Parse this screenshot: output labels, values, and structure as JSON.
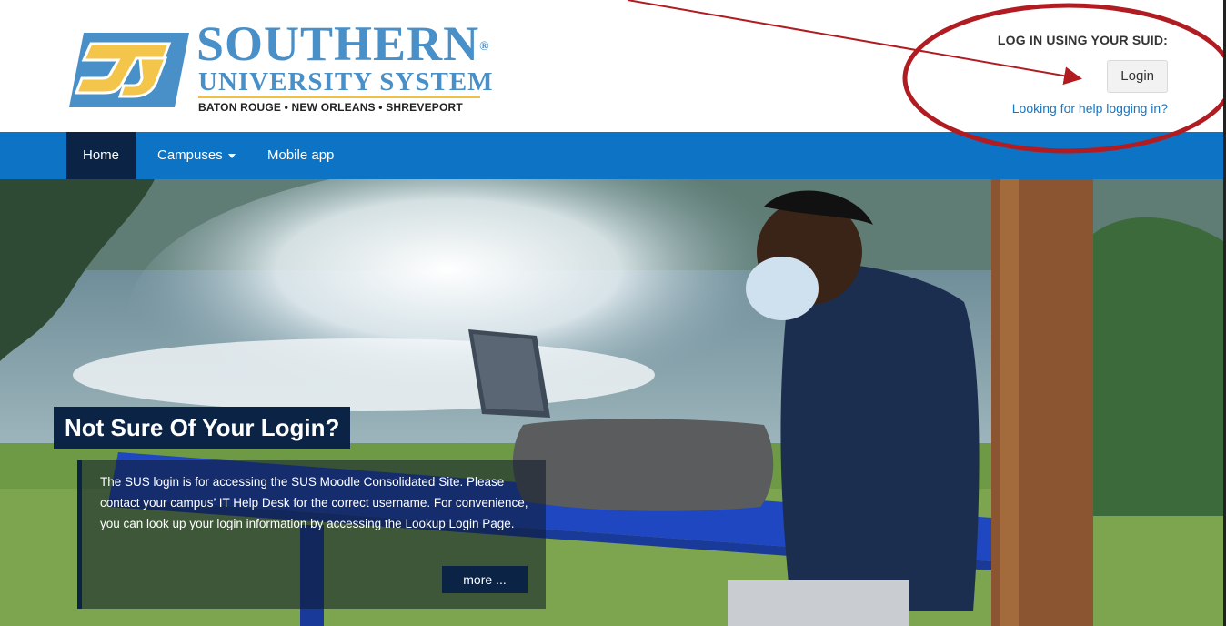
{
  "brand": {
    "name": "SOUTHERN",
    "registered": "®",
    "subtitle": "UNIVERSITY SYSTEM",
    "locations": "BATON ROUGE • NEW ORLEANS • SHREVEPORT",
    "logo_letters": "SU",
    "colors": {
      "blue": "#4a90c8",
      "gold": "#f0c040"
    }
  },
  "login_panel": {
    "title": "LOG IN USING YOUR SUID:",
    "button_label": "Login",
    "help_link": "Looking for help logging in?"
  },
  "navbar": {
    "items": [
      {
        "label": "Home",
        "active": true
      },
      {
        "label": "Campuses",
        "dropdown": true
      },
      {
        "label": "Mobile app"
      }
    ],
    "color": "#0d73c4",
    "active_color": "#0b2344"
  },
  "hero": {
    "heading": "Not Sure Of Your Login?",
    "text": "The SUS login is for accessing the SUS Moodle Consolidated Site. Please contact your campus’ IT Help Desk for the correct username. For convenience, you can look up your login information by accessing the Lookup Login Page.",
    "more_label": "more ...",
    "image_icon": "student-at-fountain-photo"
  },
  "annotation": {
    "color": "#b01c22",
    "shapes": [
      "arrow-icon",
      "circle-highlight"
    ]
  }
}
